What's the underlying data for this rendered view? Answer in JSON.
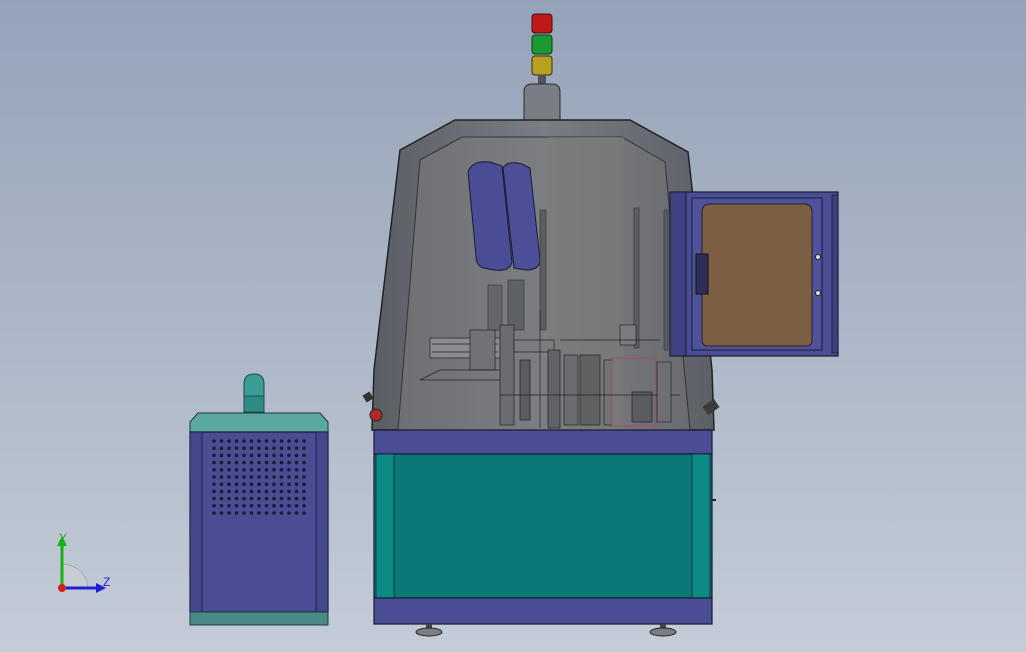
{
  "viewport": {
    "background_top": "#95a3b9",
    "background_bottom": "#c4ccd8"
  },
  "colors": {
    "frame_blue": "#4a4d96",
    "frame_teal": "#0a7878",
    "cabinet_gray": "#6f7378",
    "light_red": "#c01818",
    "light_green": "#1a9a30",
    "light_yellow": "#b8a020",
    "door_window": "#7c5e42",
    "electrical_box_top": "#5aa8a0",
    "axis_y": "#18b018",
    "axis_z": "#2020d0",
    "axis_origin": "#d02020"
  },
  "triad": {
    "y_label": "Y",
    "z_label": "Z"
  }
}
